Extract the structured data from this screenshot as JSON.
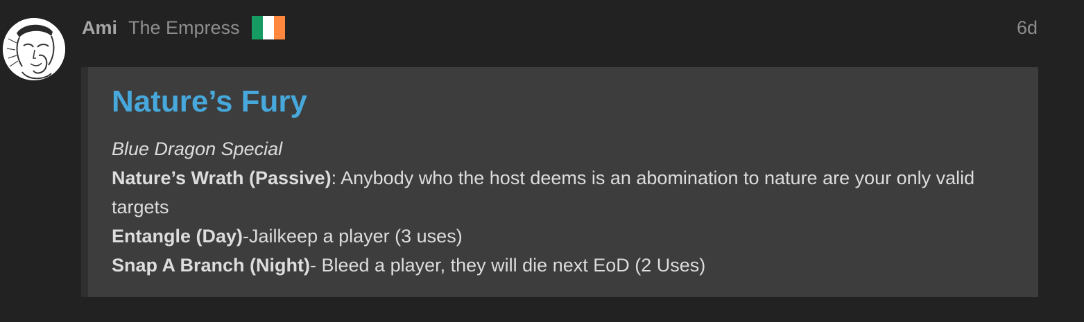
{
  "post": {
    "username": "Ami",
    "user_title": "The Empress",
    "flag_colors": [
      "#169b62",
      "#ffffff",
      "#ff883e"
    ],
    "date": "6d",
    "avatar_icon": "user-avatar-sketch"
  },
  "quote": {
    "title": "Nature’s Fury",
    "subtitle": "Blue Dragon Special",
    "abilities": [
      {
        "name": "Nature’s Wrath (Passive)",
        "separator": ": ",
        "description": "Anybody who the host deems is an abomination to nature are your only valid targets"
      },
      {
        "name": "Entangle (Day)",
        "separator": "-",
        "description": "Jailkeep a player (3 uses)"
      },
      {
        "name": "Snap A Branch (Night)",
        "separator": "- ",
        "description": "Bleed a player, they will die next EoD (2 Uses)"
      }
    ]
  }
}
